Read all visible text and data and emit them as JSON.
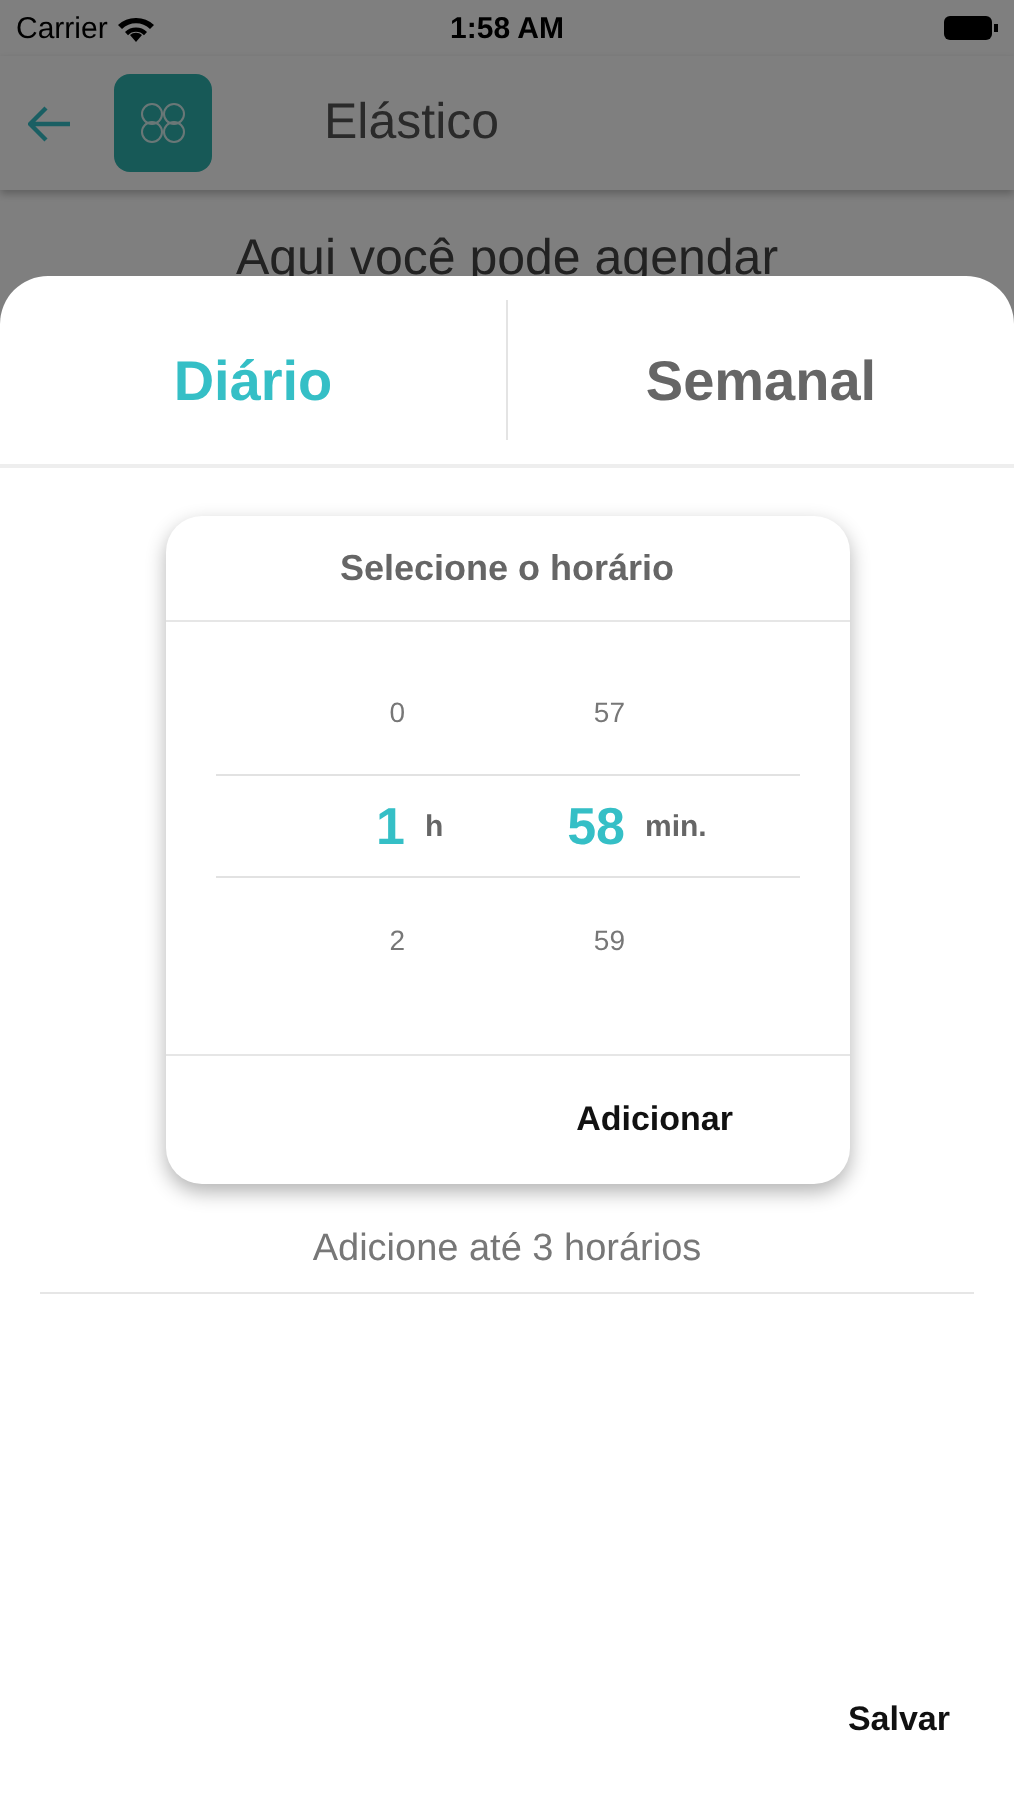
{
  "status_bar": {
    "carrier": "Carrier",
    "time": "1:58 AM"
  },
  "header": {
    "title": "Elástico"
  },
  "background_text": "Aqui você pode agendar",
  "sheet": {
    "tabs": [
      {
        "label": "Diário",
        "selected": true
      },
      {
        "label": "Semanal",
        "selected": false
      }
    ],
    "picker": {
      "title": "Selecione o horário",
      "hours": [
        {
          "value": "0",
          "selected": false
        },
        {
          "value": "1",
          "selected": true
        },
        {
          "value": "2",
          "selected": false
        }
      ],
      "hour_unit": "h",
      "minutes": [
        {
          "value": "57",
          "selected": false
        },
        {
          "value": "58",
          "selected": true
        },
        {
          "value": "59",
          "selected": false
        }
      ],
      "minute_unit": "min.",
      "add_button": "Adicionar"
    },
    "hint": "Adicione até 3 horários",
    "save_button": "Salvar"
  }
}
